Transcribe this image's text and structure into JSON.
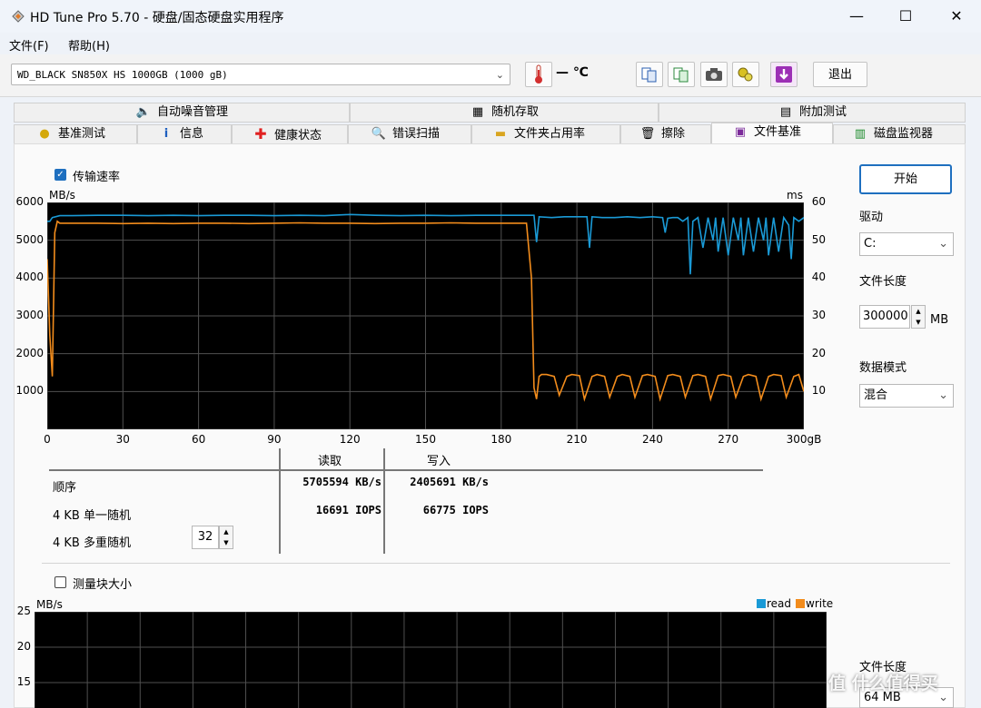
{
  "window": {
    "title": "HD Tune Pro 5.70 - 硬盘/固态硬盘实用程序",
    "minimize": "—",
    "maximize": "☐",
    "close": "✕"
  },
  "menu": {
    "file": "文件(F)",
    "help": "帮助(H)"
  },
  "toolbar": {
    "drive": "WD_BLACK SN850X HS 1000GB (1000 gB)",
    "temp": "— ℃",
    "exit_label": "退出"
  },
  "tabs_top": [
    "自动噪音管理",
    "随机存取",
    "附加测试"
  ],
  "tabs_bottom": [
    "基准测试",
    "信息",
    "健康状态",
    "错误扫描",
    "文件夹占用率",
    "擦除",
    "文件基准",
    "磁盘监视器"
  ],
  "transfer": {
    "checkbox_label": "传输速率",
    "checked": true,
    "y_unit": "MB/s",
    "y2_unit": "ms"
  },
  "results": {
    "header_read": "读取",
    "header_write": "写入",
    "rows": [
      {
        "label": "顺序",
        "read": "5705594  KB/s",
        "write": "2405691  KB/s"
      },
      {
        "label": "4 KB 单一随机",
        "read": "16691  IOPS",
        "write": "66775  IOPS"
      },
      {
        "label": "4 KB 多重随机",
        "read": "",
        "write": ""
      }
    ],
    "queue_depth": "32"
  },
  "side": {
    "start_label": "开始",
    "drive_label": "驱动",
    "drive_value": "C:",
    "file_length_label": "文件长度",
    "file_length_value": "300000",
    "file_length_unit": "MB",
    "data_mode_label": "数据模式",
    "data_mode_value": "混合",
    "file_length_label2": "文件长度",
    "file_length_value2": "64 MB"
  },
  "block": {
    "checkbox_label": "测量块大小",
    "checked": false,
    "y_unit": "MB/s",
    "legend_read": "read",
    "legend_write": "write"
  },
  "watermark": "值 什么值得买",
  "colors": {
    "read": "#1a9ad6",
    "write": "#f28c1c",
    "grid": "#505050",
    "accent": "#1e6fbf"
  },
  "chart_data": [
    {
      "type": "line",
      "title": "",
      "xlabel": "",
      "ylabel": "MB/s",
      "y2label": "ms",
      "x_unit": "gB",
      "xlim": [
        0,
        300
      ],
      "ylim": [
        0,
        6000
      ],
      "y2lim": [
        0,
        60
      ],
      "x_ticks": [
        "0",
        "30",
        "60",
        "90",
        "120",
        "150",
        "180",
        "210",
        "240",
        "270",
        "300gB"
      ],
      "y_ticks": [
        "1000",
        "2000",
        "3000",
        "4000",
        "5000",
        "6000"
      ],
      "y2_ticks": [
        "10",
        "20",
        "30",
        "40",
        "50",
        "60"
      ],
      "grid": true,
      "series": [
        {
          "name": "read",
          "x": [
            0,
            1,
            2,
            5,
            10,
            20,
            30,
            40,
            50,
            60,
            70,
            80,
            90,
            100,
            110,
            120,
            130,
            140,
            150,
            160,
            170,
            180,
            190,
            193,
            194,
            195,
            200,
            205,
            210,
            214,
            215,
            216,
            220,
            225,
            230,
            235,
            240,
            244,
            245,
            246,
            248,
            250,
            252,
            254,
            255,
            256,
            258,
            260,
            262,
            264,
            265,
            266,
            268,
            270,
            272,
            274,
            275,
            276,
            278,
            280,
            282,
            284,
            285,
            286,
            288,
            290,
            292,
            294,
            295,
            296,
            298,
            300
          ],
          "y": [
            5500,
            5500,
            5600,
            5650,
            5650,
            5660,
            5660,
            5650,
            5660,
            5650,
            5660,
            5660,
            5650,
            5660,
            5650,
            5680,
            5660,
            5650,
            5660,
            5650,
            5660,
            5660,
            5660,
            5660,
            4950,
            5620,
            5600,
            5620,
            5620,
            5620,
            4800,
            5620,
            5600,
            5600,
            5620,
            5600,
            5620,
            5600,
            5200,
            5580,
            5600,
            5600,
            5500,
            5600,
            4100,
            5500,
            5600,
            4800,
            5600,
            5000,
            5600,
            4700,
            5600,
            4600,
            5600,
            5000,
            5600,
            4600,
            5600,
            4700,
            5600,
            5000,
            5600,
            4600,
            5600,
            4700,
            5600,
            5400,
            4500,
            5600,
            5500,
            5600
          ]
        },
        {
          "name": "write",
          "x": [
            0,
            1,
            2,
            3,
            4,
            5,
            10,
            20,
            30,
            40,
            50,
            60,
            70,
            80,
            90,
            100,
            110,
            120,
            130,
            140,
            150,
            160,
            170,
            180,
            190,
            192,
            193,
            194,
            195,
            196,
            198,
            201,
            203,
            206,
            208,
            211,
            213,
            216,
            218,
            221,
            223,
            226,
            228,
            231,
            233,
            236,
            238,
            241,
            243,
            246,
            248,
            251,
            253,
            256,
            258,
            261,
            263,
            266,
            268,
            271,
            273,
            276,
            278,
            281,
            283,
            286,
            288,
            291,
            293,
            296,
            298,
            300
          ],
          "y": [
            4500,
            2500,
            1400,
            5200,
            5500,
            5450,
            5450,
            5450,
            5440,
            5450,
            5440,
            5450,
            5450,
            5440,
            5450,
            5460,
            5450,
            5450,
            5440,
            5450,
            5450,
            5460,
            5450,
            5450,
            5450,
            4000,
            1100,
            800,
            1400,
            1450,
            1450,
            1400,
            900,
            1400,
            1450,
            1420,
            800,
            1400,
            1450,
            1400,
            850,
            1400,
            1450,
            1400,
            850,
            1420,
            1450,
            1400,
            800,
            1420,
            1450,
            1400,
            850,
            1420,
            1450,
            1400,
            800,
            1420,
            1450,
            1400,
            850,
            1400,
            1450,
            1400,
            800,
            1400,
            1450,
            1420,
            850,
            1400,
            1450,
            1000
          ]
        }
      ]
    },
    {
      "type": "line",
      "ylabel": "MB/s",
      "ylim": [
        0,
        25
      ],
      "y_ticks": [
        "15",
        "20",
        "25"
      ],
      "grid": true,
      "series": [
        {
          "name": "read",
          "values": []
        },
        {
          "name": "write",
          "values": []
        }
      ]
    }
  ]
}
